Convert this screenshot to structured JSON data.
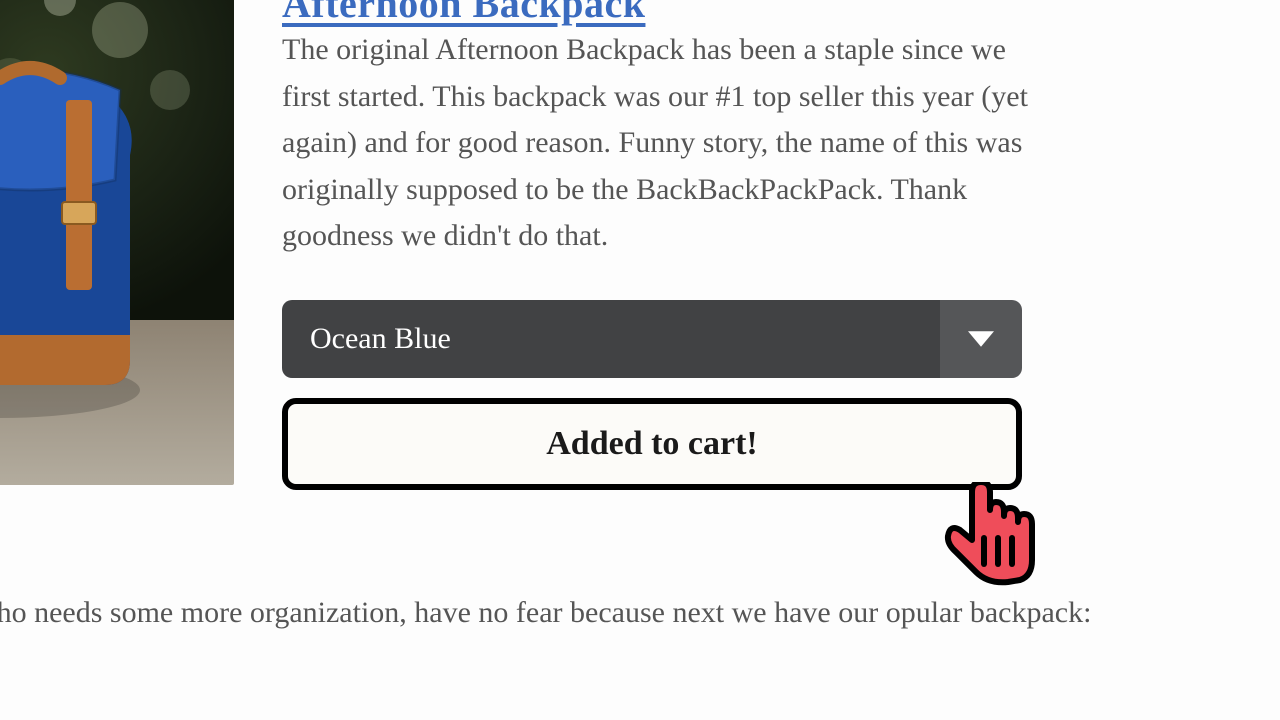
{
  "product": {
    "title": "Afternoon Backpack",
    "description": "The original Afternoon Backpack has been a staple since we first started. This backpack was our #1 top seller this year (yet again) and for good reason. Funny story, the name of this was originally supposed to be the BackBackPackPack. Thank goodness we didn't do that.",
    "color_selected": "Ocean Blue",
    "button_label": "Added to cart!"
  },
  "followup_text": "e someone who needs some more organization, have no fear because next we have our opular backpack:"
}
